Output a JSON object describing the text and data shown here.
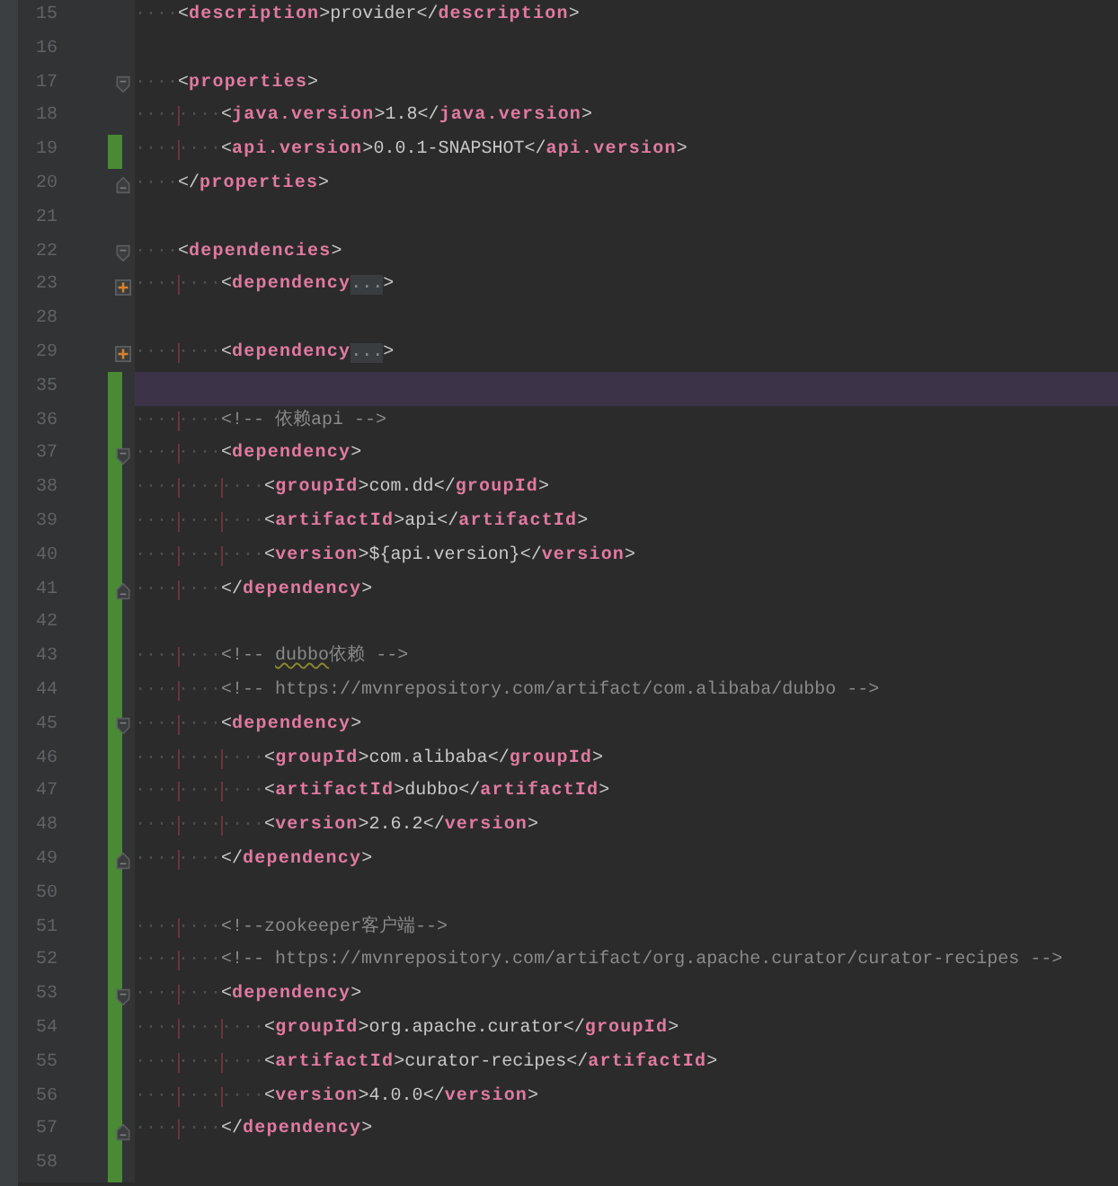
{
  "lines": [
    {
      "number": "15",
      "kind": "plain",
      "changed": false,
      "current": false,
      "tokens": [
        {
          "kind": "ws",
          "text": "····"
        },
        {
          "kind": "punct",
          "text": "<"
        },
        {
          "kind": "tag",
          "text": "description"
        },
        {
          "kind": "punct",
          "text": ">"
        },
        {
          "kind": "text",
          "text": "provider"
        },
        {
          "kind": "punct",
          "text": "</"
        },
        {
          "kind": "tag",
          "text": "description"
        },
        {
          "kind": "punct",
          "text": ">"
        }
      ]
    },
    {
      "number": "16",
      "kind": "plain",
      "changed": false,
      "current": false
    },
    {
      "number": "17",
      "kind": "opener",
      "changed": false,
      "current": false,
      "tokens": [
        {
          "kind": "ws",
          "text": "····"
        },
        {
          "kind": "punct",
          "text": "<"
        },
        {
          "kind": "tag",
          "text": "properties"
        },
        {
          "kind": "punct",
          "text": ">"
        }
      ]
    },
    {
      "number": "18",
      "kind": "plain",
      "changed": false,
      "current": false,
      "tokens": [
        {
          "kind": "ws",
          "text": "········"
        },
        {
          "kind": "punct",
          "text": "<"
        },
        {
          "kind": "tag",
          "text": "java.version"
        },
        {
          "kind": "punct",
          "text": ">"
        },
        {
          "kind": "text",
          "text": "1.8"
        },
        {
          "kind": "punct",
          "text": "</"
        },
        {
          "kind": "tag",
          "text": "java.version"
        },
        {
          "kind": "punct",
          "text": ">"
        }
      ]
    },
    {
      "number": "19",
      "kind": "plain",
      "changed": true,
      "current": false,
      "tokens": [
        {
          "kind": "ws",
          "text": "········"
        },
        {
          "kind": "punct",
          "text": "<"
        },
        {
          "kind": "tag",
          "text": "api.version"
        },
        {
          "kind": "punct",
          "text": ">"
        },
        {
          "kind": "text",
          "text": "0.0.1-SNAPSHOT"
        },
        {
          "kind": "punct",
          "text": "</"
        },
        {
          "kind": "tag",
          "text": "api.version"
        },
        {
          "kind": "punct",
          "text": ">"
        }
      ]
    },
    {
      "number": "20",
      "kind": "closer",
      "changed": false,
      "current": false,
      "tokens": [
        {
          "kind": "ws",
          "text": "····"
        },
        {
          "kind": "punct",
          "text": "</"
        },
        {
          "kind": "tag",
          "text": "properties"
        },
        {
          "kind": "punct",
          "text": ">"
        }
      ]
    },
    {
      "number": "21",
      "kind": "plain",
      "changed": false,
      "current": false
    },
    {
      "number": "22",
      "kind": "opener",
      "changed": false,
      "current": false,
      "tokens": [
        {
          "kind": "ws",
          "text": "····"
        },
        {
          "kind": "punct",
          "text": "<"
        },
        {
          "kind": "tag",
          "text": "dependencies"
        },
        {
          "kind": "punct",
          "text": ">"
        }
      ]
    },
    {
      "number": "23",
      "kind": "folded",
      "changed": false,
      "current": false,
      "tokens": [
        {
          "kind": "ws",
          "text": "········"
        },
        {
          "kind": "punct",
          "text": "<"
        },
        {
          "kind": "tag",
          "text": "dependency"
        },
        {
          "kind": "fold",
          "text": "..."
        },
        {
          "kind": "punct",
          "text": ">"
        }
      ]
    },
    {
      "number": "28",
      "kind": "plain",
      "changed": false,
      "current": false
    },
    {
      "number": "29",
      "kind": "folded",
      "changed": false,
      "current": false,
      "tokens": [
        {
          "kind": "ws",
          "text": "········"
        },
        {
          "kind": "punct",
          "text": "<"
        },
        {
          "kind": "tag",
          "text": "dependency"
        },
        {
          "kind": "fold",
          "text": "..."
        },
        {
          "kind": "punct",
          "text": ">"
        }
      ]
    },
    {
      "number": "35",
      "kind": "plain",
      "changed": true,
      "current": true
    },
    {
      "number": "36",
      "kind": "plain",
      "changed": true,
      "current": false,
      "tokens": [
        {
          "kind": "ws",
          "text": "········"
        },
        {
          "kind": "comment",
          "text": "<!-- 依赖api -->"
        }
      ]
    },
    {
      "number": "37",
      "kind": "opener",
      "changed": true,
      "current": false,
      "tokens": [
        {
          "kind": "ws",
          "text": "········"
        },
        {
          "kind": "punct",
          "text": "<"
        },
        {
          "kind": "tag",
          "text": "dependency"
        },
        {
          "kind": "punct",
          "text": ">"
        }
      ]
    },
    {
      "number": "38",
      "kind": "plain",
      "changed": true,
      "current": false,
      "tokens": [
        {
          "kind": "ws",
          "text": "············"
        },
        {
          "kind": "punct",
          "text": "<"
        },
        {
          "kind": "tag",
          "text": "groupId"
        },
        {
          "kind": "punct",
          "text": ">"
        },
        {
          "kind": "text",
          "text": "com.dd"
        },
        {
          "kind": "punct",
          "text": "</"
        },
        {
          "kind": "tag",
          "text": "groupId"
        },
        {
          "kind": "punct",
          "text": ">"
        }
      ]
    },
    {
      "number": "39",
      "kind": "plain",
      "changed": true,
      "current": false,
      "tokens": [
        {
          "kind": "ws",
          "text": "············"
        },
        {
          "kind": "punct",
          "text": "<"
        },
        {
          "kind": "tag",
          "text": "artifactId"
        },
        {
          "kind": "punct",
          "text": ">"
        },
        {
          "kind": "text",
          "text": "api"
        },
        {
          "kind": "punct",
          "text": "</"
        },
        {
          "kind": "tag",
          "text": "artifactId"
        },
        {
          "kind": "punct",
          "text": ">"
        }
      ]
    },
    {
      "number": "40",
      "kind": "plain",
      "changed": true,
      "current": false,
      "tokens": [
        {
          "kind": "ws",
          "text": "············"
        },
        {
          "kind": "punct",
          "text": "<"
        },
        {
          "kind": "tag",
          "text": "version"
        },
        {
          "kind": "punct",
          "text": ">"
        },
        {
          "kind": "text",
          "text": "${api.version}"
        },
        {
          "kind": "punct",
          "text": "</"
        },
        {
          "kind": "tag",
          "text": "version"
        },
        {
          "kind": "punct",
          "text": ">"
        }
      ]
    },
    {
      "number": "41",
      "kind": "closer",
      "changed": true,
      "current": false,
      "tokens": [
        {
          "kind": "ws",
          "text": "········"
        },
        {
          "kind": "punct",
          "text": "</"
        },
        {
          "kind": "tag",
          "text": "dependency"
        },
        {
          "kind": "punct",
          "text": ">"
        }
      ]
    },
    {
      "number": "42",
      "kind": "plain",
      "changed": true,
      "current": false
    },
    {
      "number": "43",
      "kind": "plain",
      "changed": true,
      "current": false,
      "tokens": [
        {
          "kind": "ws",
          "text": "········"
        },
        {
          "kind": "comment",
          "text": "<!-- "
        },
        {
          "kind": "typo",
          "text": "dubbo"
        },
        {
          "kind": "comment",
          "text": "依赖 -->"
        }
      ]
    },
    {
      "number": "44",
      "kind": "plain",
      "changed": true,
      "current": false,
      "tokens": [
        {
          "kind": "ws",
          "text": "········"
        },
        {
          "kind": "comment",
          "text": "<!-- https://mvnrepository.com/artifact/com.alibaba/dubbo -->"
        }
      ]
    },
    {
      "number": "45",
      "kind": "opener",
      "changed": true,
      "current": false,
      "tokens": [
        {
          "kind": "ws",
          "text": "········"
        },
        {
          "kind": "punct",
          "text": "<"
        },
        {
          "kind": "tag",
          "text": "dependency"
        },
        {
          "kind": "punct",
          "text": ">"
        }
      ]
    },
    {
      "number": "46",
      "kind": "plain",
      "changed": true,
      "current": false,
      "tokens": [
        {
          "kind": "ws",
          "text": "············"
        },
        {
          "kind": "punct",
          "text": "<"
        },
        {
          "kind": "tag",
          "text": "groupId"
        },
        {
          "kind": "punct",
          "text": ">"
        },
        {
          "kind": "text",
          "text": "com.alibaba"
        },
        {
          "kind": "punct",
          "text": "</"
        },
        {
          "kind": "tag",
          "text": "groupId"
        },
        {
          "kind": "punct",
          "text": ">"
        }
      ]
    },
    {
      "number": "47",
      "kind": "plain",
      "changed": true,
      "current": false,
      "tokens": [
        {
          "kind": "ws",
          "text": "············"
        },
        {
          "kind": "punct",
          "text": "<"
        },
        {
          "kind": "tag",
          "text": "artifactId"
        },
        {
          "kind": "punct",
          "text": ">"
        },
        {
          "kind": "text",
          "text": "dubbo"
        },
        {
          "kind": "punct",
          "text": "</"
        },
        {
          "kind": "tag",
          "text": "artifactId"
        },
        {
          "kind": "punct",
          "text": ">"
        }
      ]
    },
    {
      "number": "48",
      "kind": "plain",
      "changed": true,
      "current": false,
      "tokens": [
        {
          "kind": "ws",
          "text": "············"
        },
        {
          "kind": "punct",
          "text": "<"
        },
        {
          "kind": "tag",
          "text": "version"
        },
        {
          "kind": "punct",
          "text": ">"
        },
        {
          "kind": "text",
          "text": "2.6.2"
        },
        {
          "kind": "punct",
          "text": "</"
        },
        {
          "kind": "tag",
          "text": "version"
        },
        {
          "kind": "punct",
          "text": ">"
        }
      ]
    },
    {
      "number": "49",
      "kind": "closer",
      "changed": true,
      "current": false,
      "tokens": [
        {
          "kind": "ws",
          "text": "········"
        },
        {
          "kind": "punct",
          "text": "</"
        },
        {
          "kind": "tag",
          "text": "dependency"
        },
        {
          "kind": "punct",
          "text": ">"
        }
      ]
    },
    {
      "number": "50",
      "kind": "plain",
      "changed": true,
      "current": false
    },
    {
      "number": "51",
      "kind": "plain",
      "changed": true,
      "current": false,
      "tokens": [
        {
          "kind": "ws",
          "text": "········"
        },
        {
          "kind": "comment",
          "text": "<!--zookeeper客户端-->"
        }
      ]
    },
    {
      "number": "52",
      "kind": "plain",
      "changed": true,
      "current": false,
      "tokens": [
        {
          "kind": "ws",
          "text": "········"
        },
        {
          "kind": "comment",
          "text": "<!-- https://mvnrepository.com/artifact/org.apache.curator/curator-recipes -->"
        }
      ]
    },
    {
      "number": "53",
      "kind": "opener",
      "changed": true,
      "current": false,
      "tokens": [
        {
          "kind": "ws",
          "text": "········"
        },
        {
          "kind": "punct",
          "text": "<"
        },
        {
          "kind": "tag",
          "text": "dependency"
        },
        {
          "kind": "punct",
          "text": ">"
        }
      ]
    },
    {
      "number": "54",
      "kind": "plain",
      "changed": true,
      "current": false,
      "tokens": [
        {
          "kind": "ws",
          "text": "············"
        },
        {
          "kind": "punct",
          "text": "<"
        },
        {
          "kind": "tag",
          "text": "groupId"
        },
        {
          "kind": "punct",
          "text": ">"
        },
        {
          "kind": "text",
          "text": "org.apache.curator"
        },
        {
          "kind": "punct",
          "text": "</"
        },
        {
          "kind": "tag",
          "text": "groupId"
        },
        {
          "kind": "punct",
          "text": ">"
        }
      ]
    },
    {
      "number": "55",
      "kind": "plain",
      "changed": true,
      "current": false,
      "tokens": [
        {
          "kind": "ws",
          "text": "············"
        },
        {
          "kind": "punct",
          "text": "<"
        },
        {
          "kind": "tag",
          "text": "artifactId"
        },
        {
          "kind": "punct",
          "text": ">"
        },
        {
          "kind": "text",
          "text": "curator-recipes"
        },
        {
          "kind": "punct",
          "text": "</"
        },
        {
          "kind": "tag",
          "text": "artifactId"
        },
        {
          "kind": "punct",
          "text": ">"
        }
      ]
    },
    {
      "number": "56",
      "kind": "plain",
      "changed": true,
      "current": false,
      "tokens": [
        {
          "kind": "ws",
          "text": "············"
        },
        {
          "kind": "punct",
          "text": "<"
        },
        {
          "kind": "tag",
          "text": "version"
        },
        {
          "kind": "punct",
          "text": ">"
        },
        {
          "kind": "text",
          "text": "4.0.0"
        },
        {
          "kind": "punct",
          "text": "</"
        },
        {
          "kind": "tag",
          "text": "version"
        },
        {
          "kind": "punct",
          "text": ">"
        }
      ]
    },
    {
      "number": "57",
      "kind": "closer",
      "changed": true,
      "current": false,
      "tokens": [
        {
          "kind": "ws",
          "text": "········"
        },
        {
          "kind": "punct",
          "text": "</"
        },
        {
          "kind": "tag",
          "text": "dependency"
        },
        {
          "kind": "punct",
          "text": ">"
        }
      ]
    },
    {
      "number": "58",
      "kind": "plain",
      "changed": true,
      "current": false
    }
  ]
}
